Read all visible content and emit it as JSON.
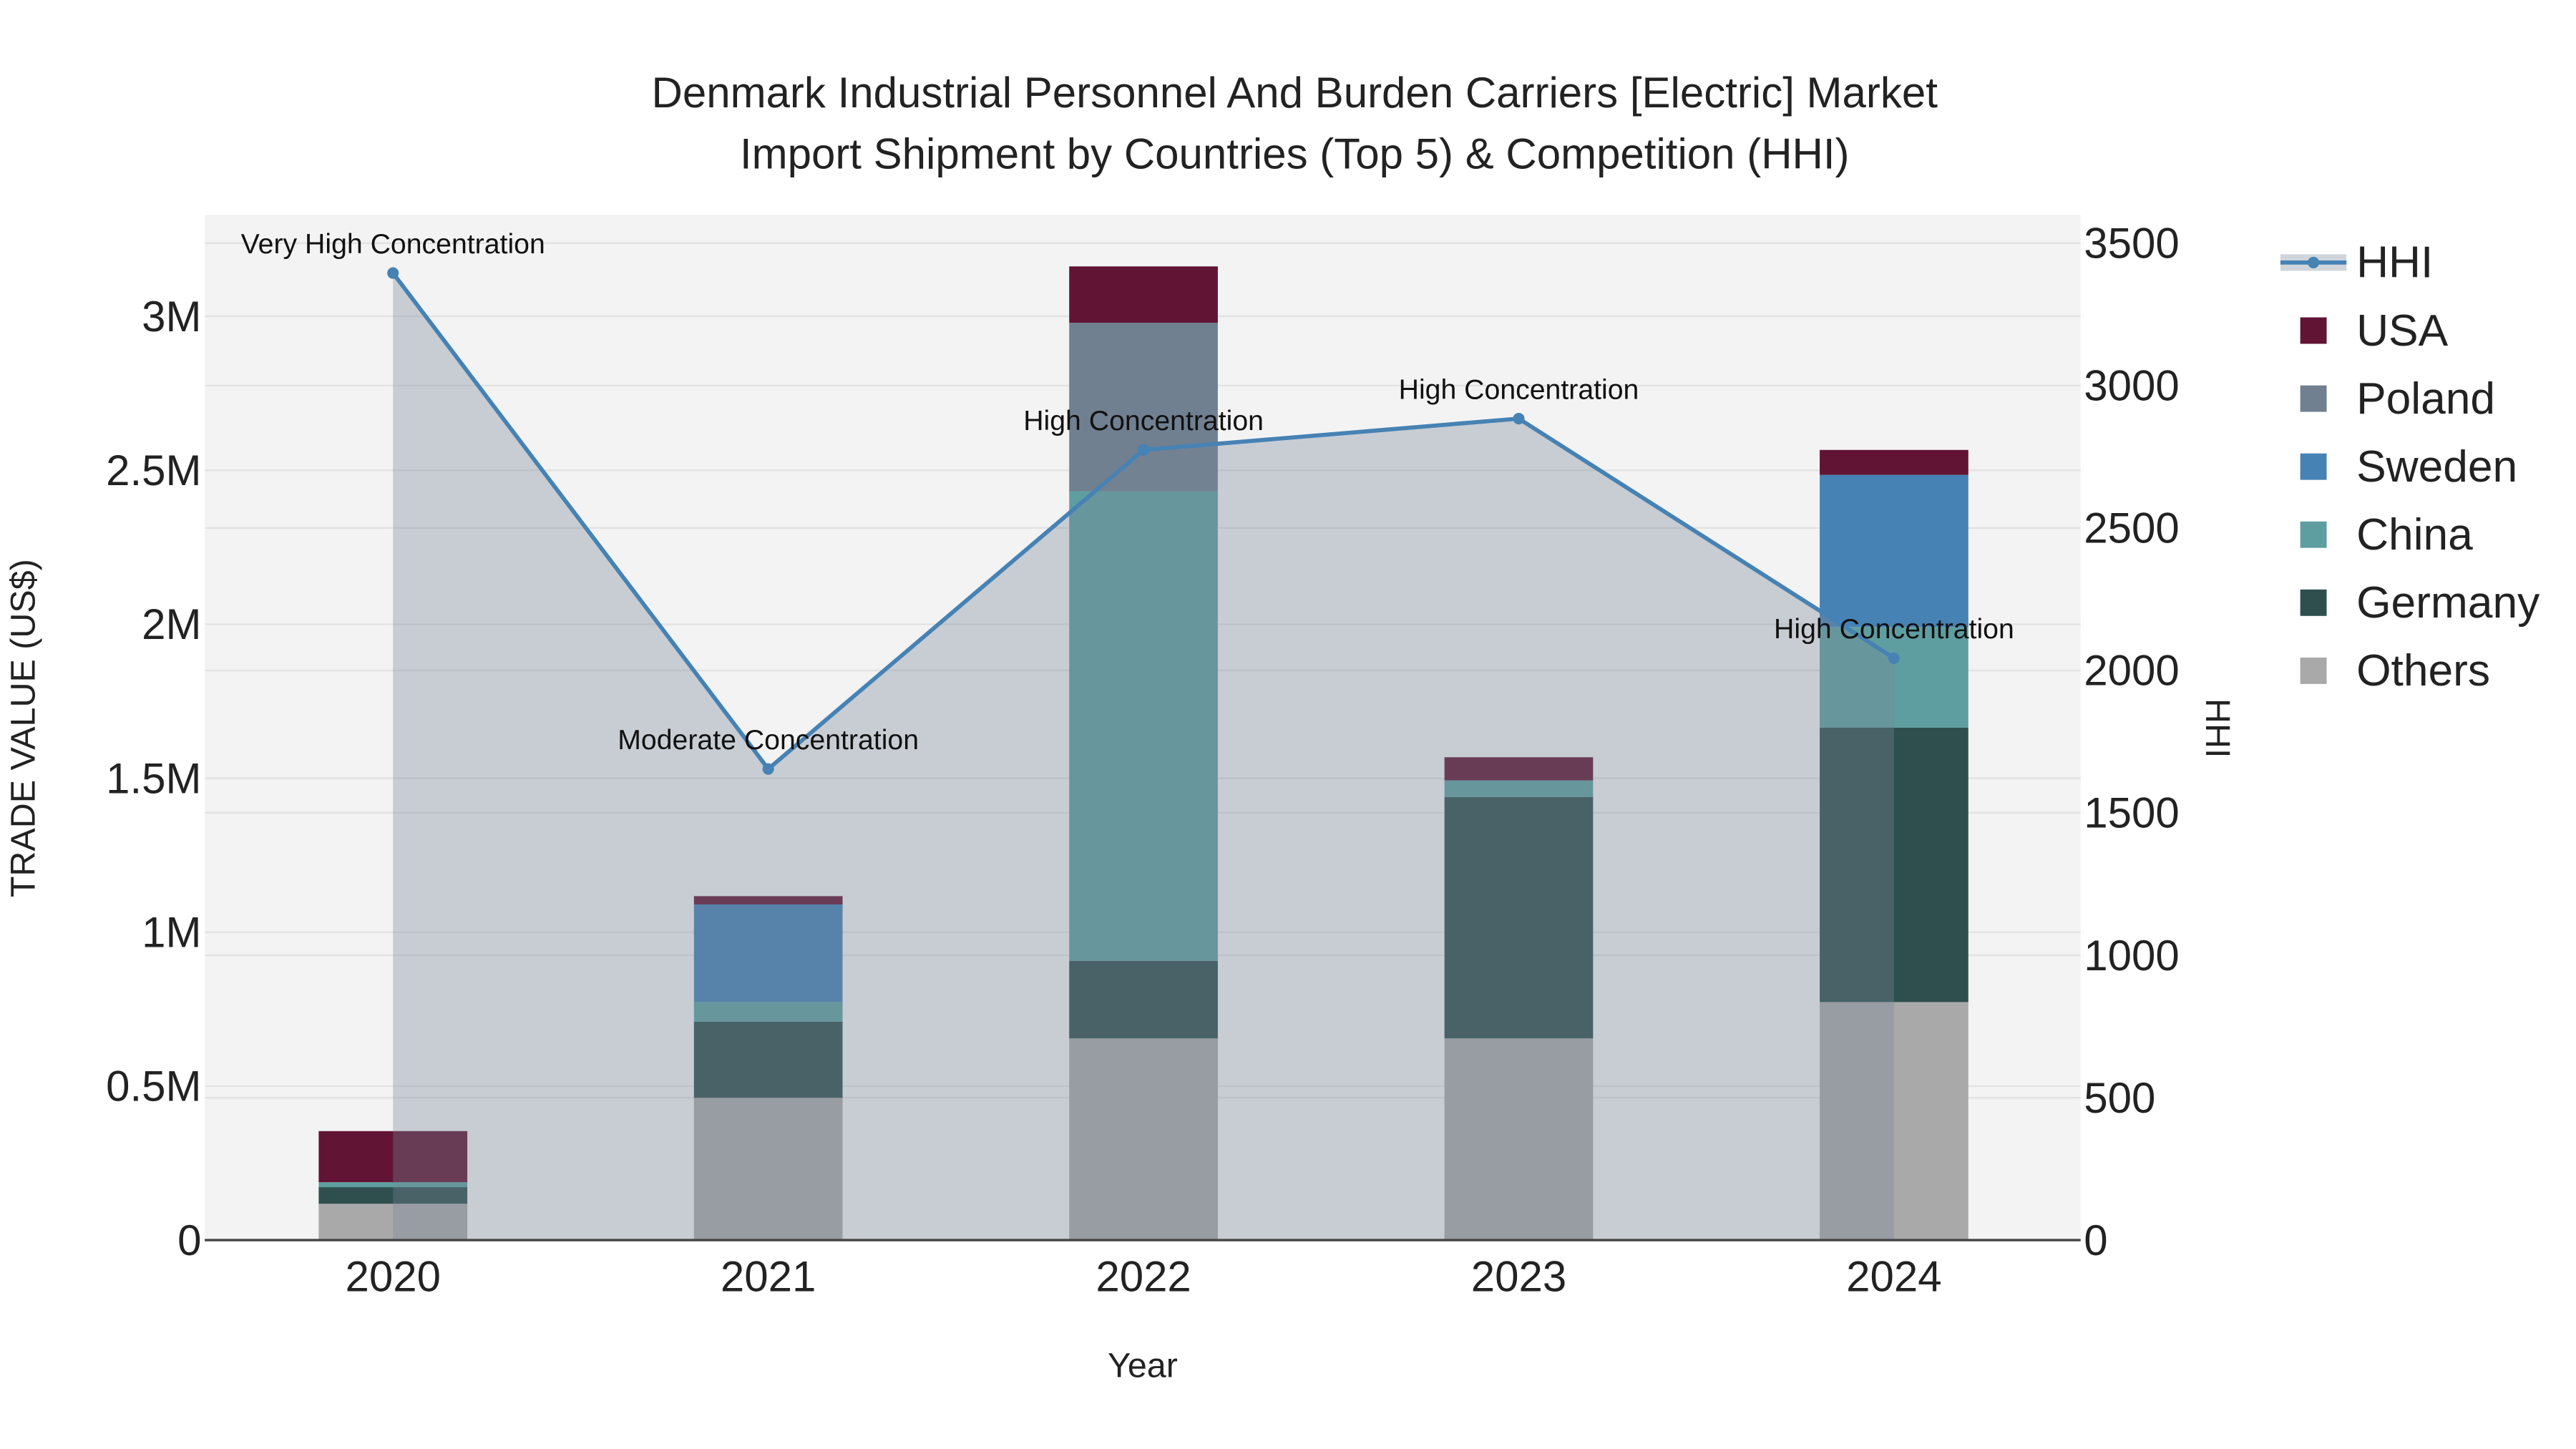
{
  "chart_data": {
    "type": "bar",
    "title_line1": "Denmark Industrial Personnel And Burden Carriers [Electric] Market",
    "title_line2": "Import Shipment by Countries (Top 5) & Competition (HHI)",
    "xlabel": "Year",
    "ylabel": "TRADE VALUE (US$)",
    "y2label": "HHI",
    "categories": [
      "2020",
      "2021",
      "2022",
      "2023",
      "2024"
    ],
    "ylim": [
      0,
      3330000
    ],
    "y2lim": [
      0,
      3600
    ],
    "yticks": [
      {
        "v": 0,
        "label": "0"
      },
      {
        "v": 500000,
        "label": "0.5M"
      },
      {
        "v": 1000000,
        "label": "1M"
      },
      {
        "v": 1500000,
        "label": "1.5M"
      },
      {
        "v": 2000000,
        "label": "2M"
      },
      {
        "v": 2500000,
        "label": "2.5M"
      },
      {
        "v": 3000000,
        "label": "3M"
      }
    ],
    "y2ticks": [
      {
        "v": 0,
        "label": "0"
      },
      {
        "v": 500,
        "label": "500"
      },
      {
        "v": 1000,
        "label": "1000"
      },
      {
        "v": 1500,
        "label": "1500"
      },
      {
        "v": 2000,
        "label": "2000"
      },
      {
        "v": 2500,
        "label": "2500"
      },
      {
        "v": 3000,
        "label": "3000"
      },
      {
        "v": 3500,
        "label": "3500"
      }
    ],
    "series": [
      {
        "name": "Others",
        "color": "#A9A9A9",
        "values": [
          118000,
          462000,
          655000,
          655000,
          773000
        ]
      },
      {
        "name": "Germany",
        "color": "#2F4F4F",
        "values": [
          54000,
          247000,
          252000,
          784000,
          891000
        ]
      },
      {
        "name": "China",
        "color": "#5F9EA0",
        "values": [
          16000,
          64000,
          1525000,
          54000,
          327000
        ]
      },
      {
        "name": "Sweden",
        "color": "#4682B4",
        "values": [
          0,
          317000,
          0,
          0,
          494000
        ]
      },
      {
        "name": "Poland",
        "color": "#708090",
        "values": [
          0,
          0,
          547000,
          0,
          0
        ]
      },
      {
        "name": "USA",
        "color": "#611434",
        "values": [
          166000,
          27000,
          183000,
          75000,
          81000
        ]
      }
    ],
    "hhi": {
      "name": "HHI",
      "color": "#4682B4",
      "values": [
        3395,
        1654,
        2774,
        2884,
        2043
      ],
      "annotations": [
        "Very High Concentration",
        "Moderate Concentration",
        "High Concentration",
        "High Concentration",
        "High Concentration"
      ]
    },
    "legend": [
      "HHI",
      "USA",
      "Poland",
      "Sweden",
      "China",
      "Germany",
      "Others"
    ],
    "legend_position": "top-right",
    "grid": true
  }
}
